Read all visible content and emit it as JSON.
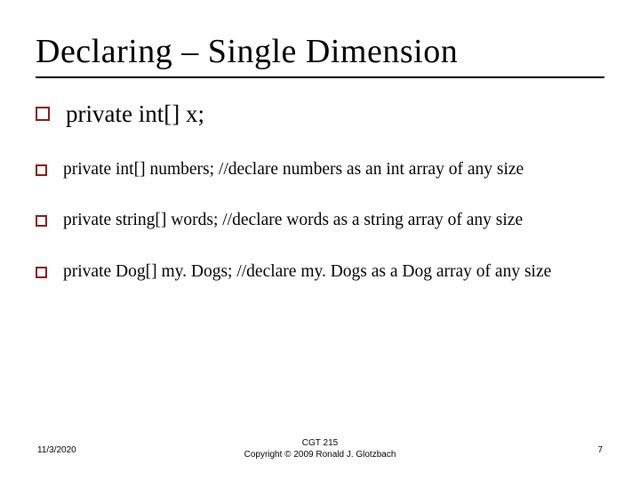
{
  "title": "Declaring – Single Dimension",
  "bullets": [
    {
      "size": "large",
      "text": "private int[] x;"
    },
    {
      "size": "small",
      "text": "private int[] numbers;   //declare numbers as an int array of any size"
    },
    {
      "size": "small",
      "text": "private string[] words;  //declare words as a string array of any size"
    },
    {
      "size": "small",
      "text": "private Dog[] my. Dogs;    //declare my. Dogs as a Dog array of any size"
    }
  ],
  "footer": {
    "date": "11/3/2020",
    "course": "CGT 215",
    "copyright": "Copyright © 2009 Ronald J. Glotzbach",
    "page": "7"
  },
  "colors": {
    "bullet_border": "#8b1a1a"
  }
}
